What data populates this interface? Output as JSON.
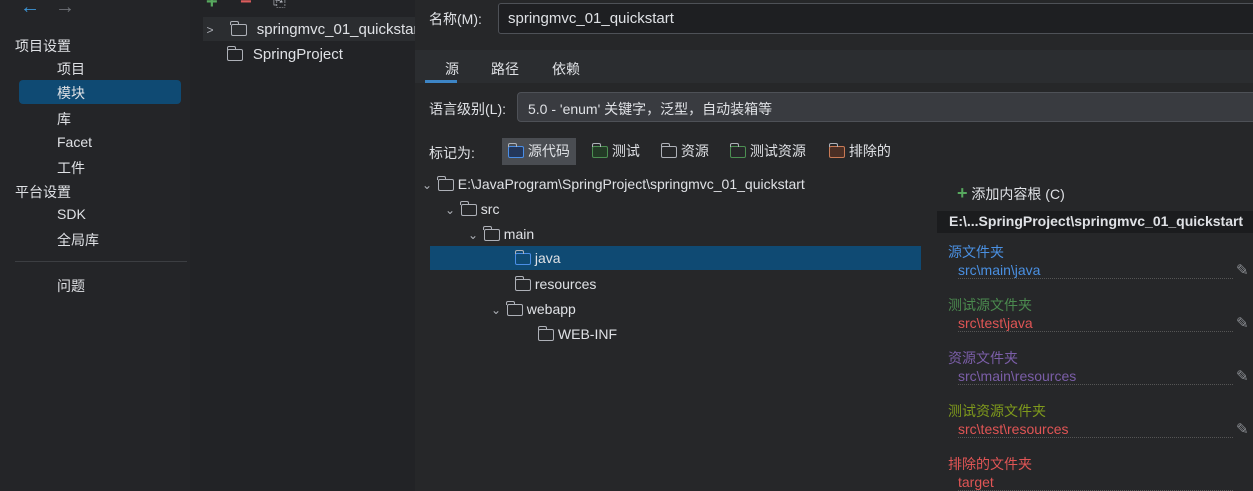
{
  "nav": {
    "back": "←",
    "forward": "→"
  },
  "sidebar": {
    "section1": "项目设置",
    "items1": [
      "项目",
      "模块",
      "库",
      "Facet",
      "工件"
    ],
    "section2": "平台设置",
    "items2": [
      "SDK",
      "全局库"
    ],
    "problems": "问题"
  },
  "modules": {
    "toolbar": {
      "add": "+",
      "remove": "−",
      "copy": "⎘"
    },
    "items": [
      "springmvc_01_quickstart",
      "SpringProject"
    ]
  },
  "main": {
    "name_label": "名称(M):",
    "name_value": "springmvc_01_quickstart",
    "tabs": [
      "源",
      "路径",
      "依赖"
    ],
    "lang_label": "语言级别(L):",
    "lang_value": "5.0 - 'enum' 关键字，泛型，自动装箱等",
    "mark_label": "标记为:",
    "marks": [
      "源代码",
      "测试",
      "资源",
      "测试资源",
      "排除的"
    ],
    "tree": [
      "E:\\JavaProgram\\SpringProject\\springmvc_01_quickstart",
      "src",
      "main",
      "java",
      "resources",
      "webapp",
      "WEB-INF"
    ],
    "add_root": "添加内容根 (C)",
    "root_path": "E:\\...SpringProject\\springmvc_01_quickstart",
    "folders": [
      {
        "title": "源文件夹",
        "path": "src\\main\\java",
        "color": "#4a90e2",
        "path_color": "#4a90e2"
      },
      {
        "title": "测试源文件夹",
        "path": "src\\test\\java",
        "color": "#4b8a4f",
        "path_color": "#e05555"
      },
      {
        "title": "资源文件夹",
        "path": "src\\main\\resources",
        "color": "#7b5ea8",
        "path_color": "#7b5ea8"
      },
      {
        "title": "测试资源文件夹",
        "path": "src\\test\\resources",
        "color": "#7f9a1c",
        "path_color": "#e05555"
      },
      {
        "title": "排除的文件夹",
        "path": "target",
        "color": "#e05555",
        "path_color": "#e05555"
      }
    ]
  }
}
